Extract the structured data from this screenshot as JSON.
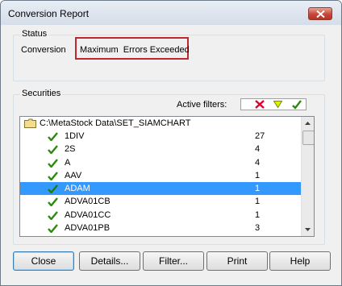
{
  "window": {
    "title": "Conversion Report"
  },
  "status": {
    "group_label": "Status",
    "conversion_label": "Conversion",
    "conversion_value": "Maximum  Errors Exceeded",
    "highlight_color": "#c0272d"
  },
  "securities": {
    "group_label": "Securities",
    "active_filters_label": "Active filters:",
    "filter_icons": [
      "red-x-icon",
      "yellow-triangle-icon",
      "green-check-icon"
    ],
    "folder_path": "C:\\MetaStock Data\\SET_SIAMCHART",
    "rows": [
      {
        "name": "1DIV",
        "count": "27",
        "selected": false
      },
      {
        "name": "2S",
        "count": "4",
        "selected": false
      },
      {
        "name": "A",
        "count": "4",
        "selected": false
      },
      {
        "name": "AAV",
        "count": "1",
        "selected": false
      },
      {
        "name": "ADAM",
        "count": "1",
        "selected": true
      },
      {
        "name": "ADVA01CB",
        "count": "1",
        "selected": false
      },
      {
        "name": "ADVA01CC",
        "count": "1",
        "selected": false
      },
      {
        "name": "ADVA01PB",
        "count": "3",
        "selected": false
      }
    ],
    "selection_color": "#3399ff"
  },
  "buttons": {
    "close": "Close",
    "details": "Details...",
    "filter": "Filter...",
    "print": "Print",
    "help": "Help"
  }
}
